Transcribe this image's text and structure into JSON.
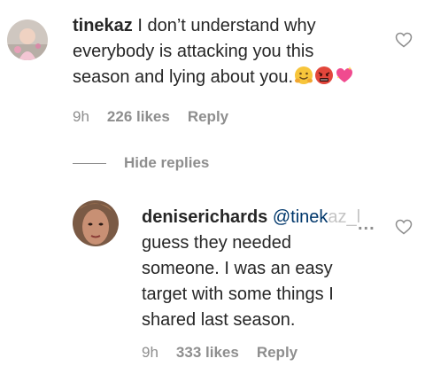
{
  "comment": {
    "username": "tinekaz",
    "text_line1": "I don’t understand why",
    "text_line2": "everybody is attacking you this",
    "text_line3": "season and lying about you.",
    "emojis": [
      "hugging-face-emoji",
      "angry-face-emoji",
      "sparkling-heart-emoji"
    ],
    "time": "9h",
    "likes": "226 likes",
    "reply_label": "Reply"
  },
  "hide_replies_label": "Hide replies",
  "reply": {
    "username": "deniserichards",
    "mention_visible": "@tinek",
    "mention_faded": "az_l",
    "ellipsis": "...",
    "text_line1": "guess they needed",
    "text_line2": "someone. I was an easy",
    "text_line3": "target with some things I",
    "text_line4": "shared last season.",
    "time": "9h",
    "likes": "333 likes",
    "reply_label": "Reply"
  },
  "colors": {
    "text": "#262626",
    "secondary": "#8e8e8e",
    "mention": "#00376b"
  }
}
